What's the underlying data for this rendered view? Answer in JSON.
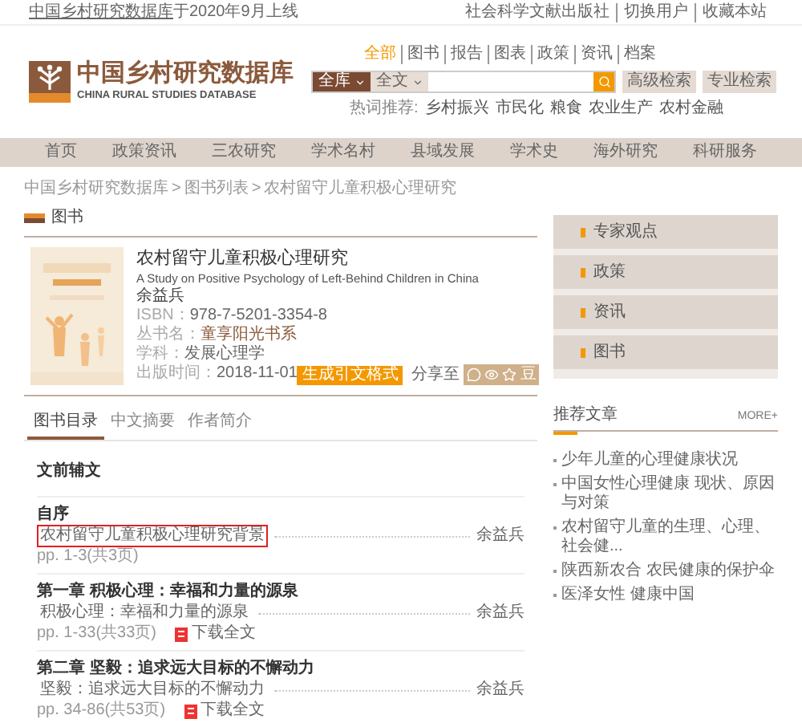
{
  "top_bar": {
    "notice_link": "中国乡村研究数据库",
    "notice_rest": "于2020年9月上线",
    "links": [
      "社会科学文献出版社",
      "切换用户",
      "收藏本站"
    ]
  },
  "logo": {
    "title": "中国乡村研究数据库",
    "subtitle": "CHINA RURAL STUDIES DATABASE"
  },
  "search": {
    "types": [
      {
        "label": "全部",
        "selected": true
      },
      {
        "label": "图书",
        "selected": false
      },
      {
        "label": "报告",
        "selected": false
      },
      {
        "label": "图表",
        "selected": false
      },
      {
        "label": "政策",
        "selected": false
      },
      {
        "label": "资讯",
        "selected": false
      },
      {
        "label": "档案",
        "selected": false
      }
    ],
    "scope": "全库",
    "field": "全文",
    "buttons": [
      "高级检索",
      "专业检索"
    ],
    "hot_label": "热词推荐:",
    "hot_words": [
      "乡村振兴",
      "市民化",
      "粮食",
      "农业生产",
      "农村金融"
    ]
  },
  "nav": [
    "首页",
    "政策资讯",
    "三农研究",
    "学术名村",
    "县域发展",
    "学术史",
    "海外研究",
    "科研服务"
  ],
  "breadcrumb": [
    "中国乡村研究数据库",
    "图书列表",
    "农村留守儿童积极心理研究"
  ],
  "breadcrumb_separator": ">",
  "section_title": "图书",
  "book": {
    "title": "农村留守儿童积极心理研究",
    "title_en": "A Study on Positive Psychology of Left-Behind Children in China",
    "author": "余益兵",
    "fields": [
      {
        "label": "ISBN：",
        "value": "978-7-5201-3354-8",
        "kind": "plain"
      },
      {
        "label": "丛书名：",
        "value": "童享阳光书系",
        "kind": "link"
      },
      {
        "label": "学科：",
        "value": "发展心理学",
        "kind": "plain"
      },
      {
        "label": "出版时间：",
        "value": "2018-11-01",
        "kind": "plain"
      }
    ],
    "cite_button": "生成引文格式",
    "share_label": "分享至",
    "share_glyph": "豆"
  },
  "tabs": [
    {
      "label": "图书目录",
      "selected": true
    },
    {
      "label": "中文摘要",
      "selected": false
    },
    {
      "label": "作者简介",
      "selected": false
    }
  ],
  "toc": [
    {
      "kind": "heading",
      "title": "文前辅文"
    },
    {
      "kind": "chapter",
      "title": "自序",
      "article": "农村留守儿童积极心理研究背景",
      "author": "余益兵",
      "pages": "pp. 1-3(共3页)",
      "highlighted": true
    },
    {
      "kind": "chapter",
      "title": "第一章 积极心理：幸福和力量的源泉",
      "article": "积极心理：幸福和力量的源泉",
      "author": "余益兵",
      "pages": "pp. 1-33(共33页)",
      "download": "下载全文",
      "highlighted": false
    },
    {
      "kind": "chapter",
      "title": "第二章 坚毅：追求远大目标的不懈动力",
      "article": "坚毅：追求远大目标的不懈动力",
      "author": "余益兵",
      "pages": "pp. 34-86(共53页)",
      "download": "下载全文",
      "highlighted": false
    }
  ],
  "side_menu": [
    "专家观点",
    "政策",
    "资讯",
    "图书"
  ],
  "recommended": {
    "title": "推荐文章",
    "more": "MORE+",
    "items": [
      "少年儿童的心理健康状况",
      "中国女性心理健康 现状、原因与对策",
      "农村留守儿童的生理、心理、社会健...",
      "陕西新农合 农民健康的保护伞",
      "医泽女性 健康中国"
    ]
  }
}
